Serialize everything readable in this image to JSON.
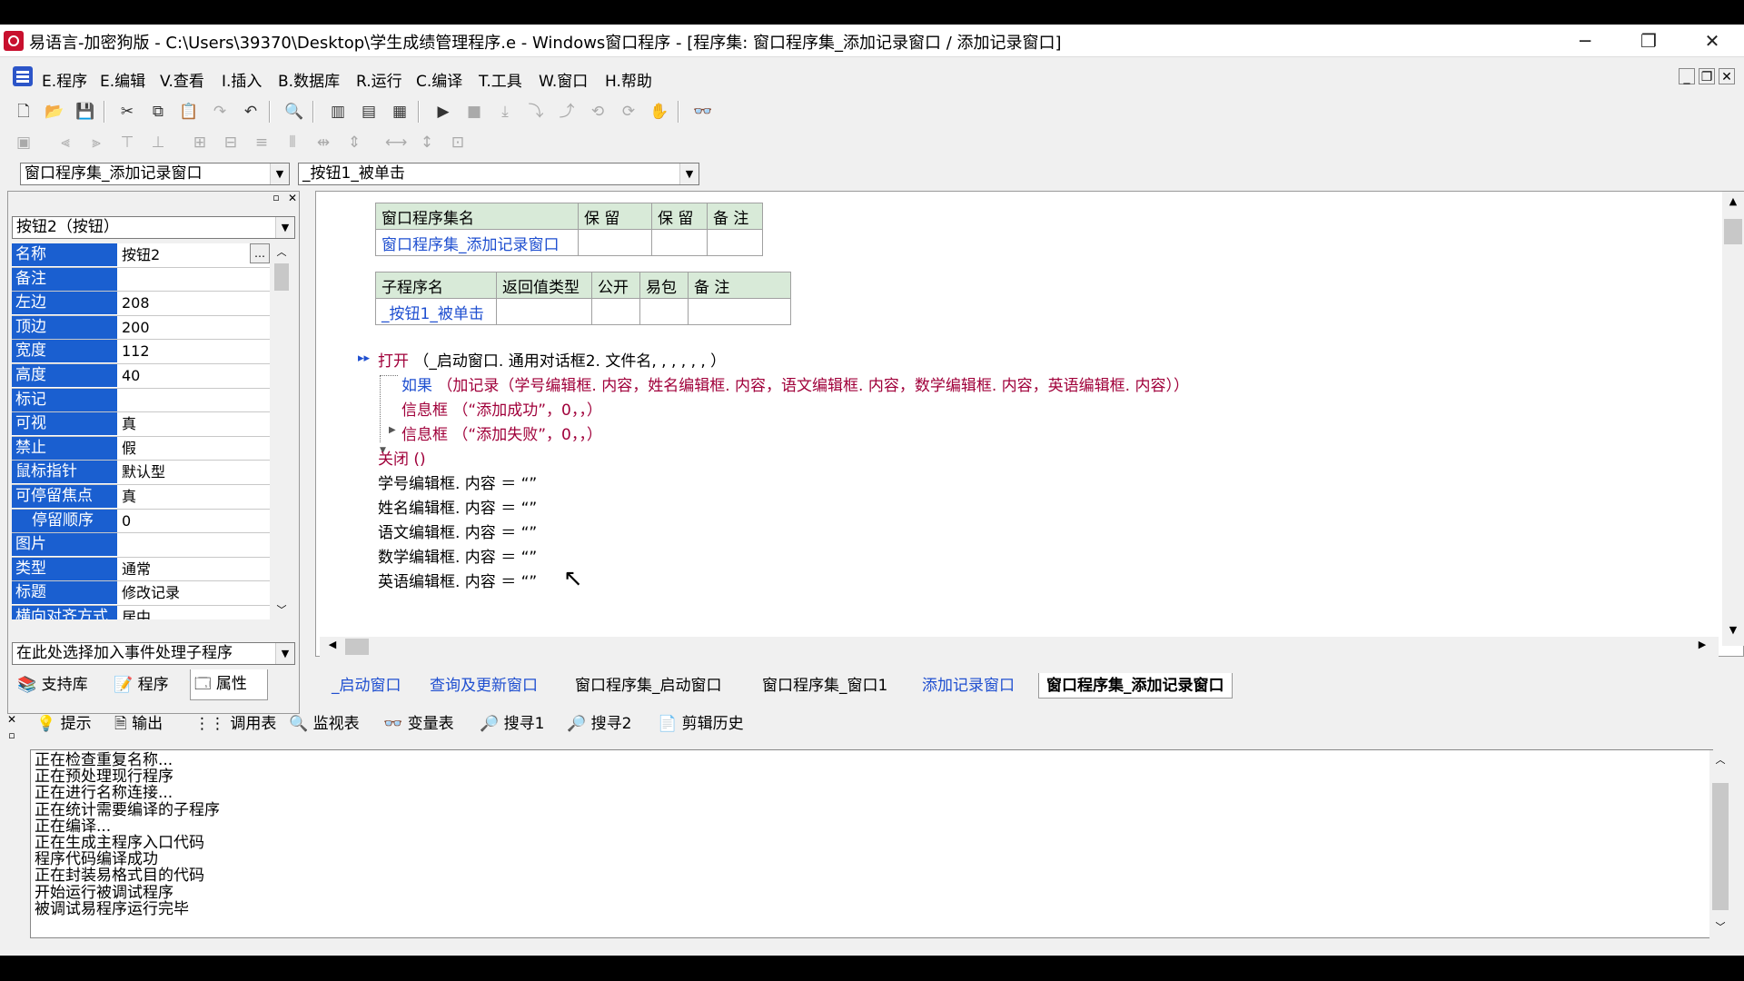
{
  "window": {
    "title": "易语言-加密狗版 - C:\\Users\\39370\\Desktop\\学生成绩管理程序.e - Windows窗口程序 - [程序集: 窗口程序集_添加记录窗口 / 添加记录窗口]",
    "minimize": "─",
    "restore": "❐",
    "close": "✕"
  },
  "menu": [
    "E.程序",
    "E.编辑",
    "V.查看",
    "I.插入",
    "B.数据库",
    "R.运行",
    "C.编译",
    "T.工具",
    "W.窗口",
    "H.帮助"
  ],
  "selectors": {
    "assembly": "窗口程序集_添加记录窗口",
    "subroutine": "_按钮1_被单击"
  },
  "properties": {
    "object": "按钮2（按钮）",
    "rows": [
      {
        "name": "名称",
        "value": "按钮2"
      },
      {
        "name": "备注",
        "value": ""
      },
      {
        "name": "左边",
        "value": "208"
      },
      {
        "name": "顶边",
        "value": "200"
      },
      {
        "name": "宽度",
        "value": "112"
      },
      {
        "name": "高度",
        "value": "40"
      },
      {
        "name": "标记",
        "value": ""
      },
      {
        "name": "可视",
        "value": "真"
      },
      {
        "name": "禁止",
        "value": "假"
      },
      {
        "name": "鼠标指针",
        "value": "默认型"
      },
      {
        "name": "可停留焦点",
        "value": "真"
      },
      {
        "name": "停留顺序",
        "value": "0"
      },
      {
        "name": "图片",
        "value": ""
      },
      {
        "name": "类型",
        "value": "通常"
      },
      {
        "name": "标题",
        "value": "修改记录"
      },
      {
        "name": "横向对齐方式",
        "value": "居中"
      }
    ],
    "event_combo": "在此处选择加入事件处理子程序"
  },
  "left_tabs": [
    "支持库",
    "程序",
    "属性"
  ],
  "assembly_table": {
    "headers": [
      "窗口程序集名",
      "保 留",
      "保 留",
      "备 注"
    ],
    "row": [
      "窗口程序集_添加记录窗口",
      "",
      "",
      ""
    ]
  },
  "sub_table": {
    "headers": [
      "子程序名",
      "返回值类型",
      "公开",
      "易包",
      "备 注"
    ],
    "row": [
      "_按钮1_被单击",
      "",
      "",
      "",
      ""
    ]
  },
  "code": {
    "line1_kw": "打开",
    "line1_rest": "（_启动窗口. 通用对话框2. 文件名, , , , , , ）",
    "line2_kw": "如果",
    "line2_rest": "（加记录（学号编辑框. 内容，姓名编辑框. 内容，语文编辑框. 内容，数学编辑框. 内容，英语编辑框. 内容））",
    "line3_kw": "信息框",
    "line3_str": "（“添加成功”，0，，）",
    "line4_kw": "信息框",
    "line4_str": "（“添加失败”，0，，）",
    "line5": "关闭 ()",
    "assign": [
      "学号编辑框. 内容 ＝ “”",
      "姓名编辑框. 内容 ＝ “”",
      "语文编辑框. 内容 ＝ “”",
      "数学编辑框. 内容 ＝ “”",
      "英语编辑框. 内容 ＝ “”"
    ]
  },
  "doc_tabs": [
    "_启动窗口",
    "查询及更新窗口",
    "窗口程序集_启动窗口",
    "窗口程序集_窗口1",
    "添加记录窗口",
    "窗口程序集_添加记录窗口"
  ],
  "bottom_tabs": [
    "提示",
    "输出",
    "调用表",
    "监视表",
    "变量表",
    "搜寻1",
    "搜寻2",
    "剪辑历史"
  ],
  "output_lines": [
    "正在检查重复名称...",
    "正在预处理现行程序",
    "正在进行名称连接...",
    "正在统计需要编译的子程序",
    "正在编译...",
    "正在生成主程序入口代码",
    "程序代码编译成功",
    "正在封装易格式目的代码",
    "开始运行被调试程序",
    "被调试易程序运行完毕"
  ]
}
